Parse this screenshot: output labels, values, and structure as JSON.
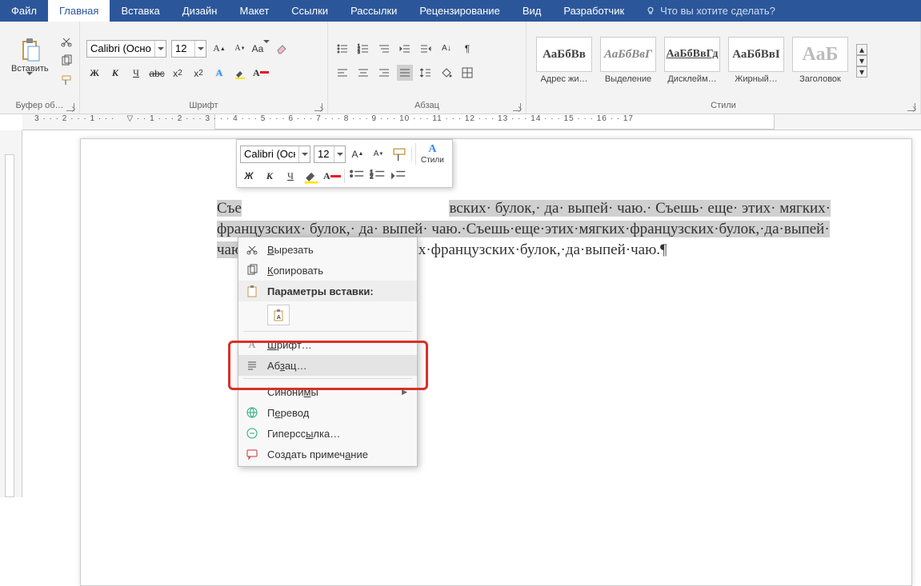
{
  "tabs": {
    "file": "Файл",
    "home": "Главная",
    "insert": "Вставка",
    "design": "Дизайн",
    "layout": "Макет",
    "references": "Ссылки",
    "mailings": "Рассылки",
    "review": "Рецензирование",
    "view": "Вид",
    "developer": "Разработчик",
    "tell": "Что вы хотите сделать?"
  },
  "ribbon": {
    "clipboard": {
      "paste": "Вставить",
      "label": "Буфер об…"
    },
    "font": {
      "name": "Calibri (Осно",
      "size": "12",
      "label": "Шрифт"
    },
    "paragraph": {
      "label": "Абзац"
    },
    "styles": {
      "label": "Стили",
      "preview": "АаБбВв",
      "preview_i": "АаБбВвГ",
      "preview_u": "АаБбВвГд",
      "preview_b": "АаБбВвІ",
      "preview_h": "АаБ",
      "s1": "Адрес жи…",
      "s2": "Выделение",
      "s3": "Дисклейм…",
      "s4": "Жирный…",
      "s5": "Заголовок"
    }
  },
  "document": {
    "line1_a": "Съе",
    "line1_b": "вских· булок,· да· выпей· чаю.· Съешь· еще· этих· мягких·",
    "line2": "французских· булок,· да· выпей· чаю.·Съешь·еще·этих·мягких·французских·булок,·да·выпей·",
    "line3_a": "чаю",
    "line3_b": "их·французских·булок,·да·выпей·чаю.¶"
  },
  "mini": {
    "font": "Calibri (Осн",
    "size": "12",
    "styles": "Стили"
  },
  "context": {
    "cut": "Вырезать",
    "copy": "Копировать",
    "paste_header": "Параметры вставки:",
    "font": "Шрифт…",
    "paragraph": "Абзац…",
    "synonyms": "Синонимы",
    "translate": "Перевод",
    "hyperlink": "Гиперссылка…",
    "comment": "Создать примечание"
  }
}
